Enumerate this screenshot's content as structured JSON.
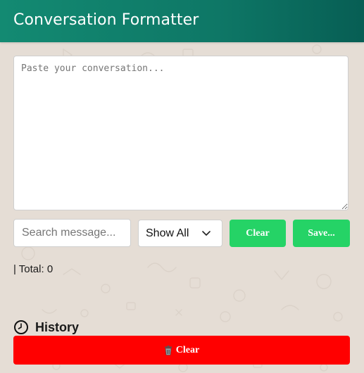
{
  "header": {
    "title": "Conversation Formatter"
  },
  "input": {
    "placeholder": "Paste your conversation..."
  },
  "controls": {
    "search_placeholder": "Search message...",
    "filter_selected": "Show All",
    "clear_label": "Clear",
    "save_label": "Save..."
  },
  "status": {
    "total_text": "| Total: 0"
  },
  "history": {
    "title": "History",
    "clear_label": "Clear"
  },
  "icons": {
    "history": "clock-icon",
    "history_clear": "trash-icon",
    "filter": "chevron-down-icon"
  },
  "colors": {
    "header_start": "#138a72",
    "header_end": "#075e54",
    "accent_green": "#25d366",
    "danger_red": "#ff0000",
    "background": "#e5ddd5"
  }
}
